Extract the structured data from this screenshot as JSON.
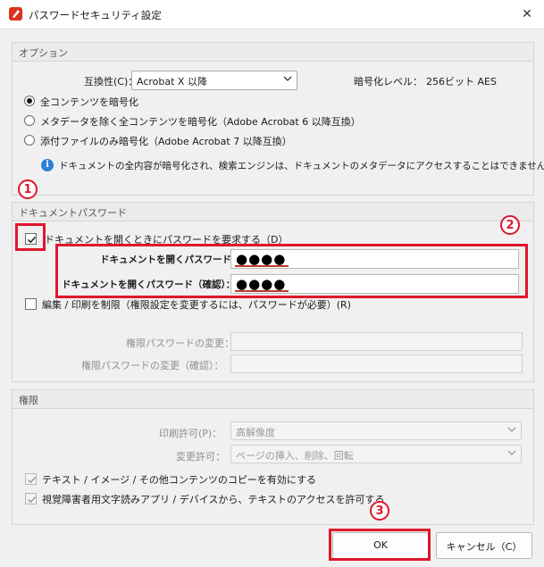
{
  "window": {
    "title": "パスワードセキュリティ設定",
    "close_glyph": "✕"
  },
  "options": {
    "group_title": "オプション",
    "compat_label": "互換性(C)：",
    "compat_value": "Acrobat X 以降",
    "encryption_level_label": "暗号化レベル：",
    "encryption_level_value": "256ビット AES",
    "radios": [
      {
        "label": "全コンテンツを暗号化",
        "selected": true
      },
      {
        "label": "メタデータを除く全コンテンツを暗号化（Adobe Acrobat 6 以降互換）",
        "selected": false
      },
      {
        "label": "添付ファイルのみ暗号化（Adobe Acrobat 7 以降互換）",
        "selected": false
      }
    ],
    "info_glyph": "i",
    "info_text": "ドキュメントの全内容が暗号化され、検索エンジンは、ドキュメントのメタデータにアクセスすることはできません。"
  },
  "doc_password": {
    "group_title": "ドキュメントパスワード",
    "require_open_label": "ドキュメントを開くときにパスワードを要求する（D）",
    "require_open_checked": true,
    "open_pw_label": "ドキュメントを開くパスワード：",
    "open_pw_value": "●●●●",
    "open_pw_confirm_label": "ドキュメントを開くパスワード（確認）：",
    "open_pw_confirm_value": "●●●●",
    "restrict_label": "編集 / 印刷を制限（権限設定を変更するには、パスワードが必要）(R)",
    "restrict_checked": false,
    "perm_pw_label": "権限パスワードの変更：",
    "perm_pw_confirm_label": "権限パスワードの変更（確認）："
  },
  "permissions": {
    "group_title": "権限",
    "print_label": "印刷許可(P)：",
    "print_value": "高解像度",
    "change_label": "変更許可：",
    "change_value": "ページの挿入、削除、回転",
    "copy_label": "テキスト / イメージ / その他コンテンツのコピーを有効にする",
    "copy_checked": true,
    "access_label": "視覚障害者用文字読みアプリ / デバイスから、テキストのアクセスを許可する",
    "access_checked": true
  },
  "buttons": {
    "ok": "OK",
    "cancel": "キャンセル（C）"
  },
  "annotations": {
    "badge1": "1",
    "badge2": "2",
    "badge3": "3",
    "color": "#e0162b"
  }
}
